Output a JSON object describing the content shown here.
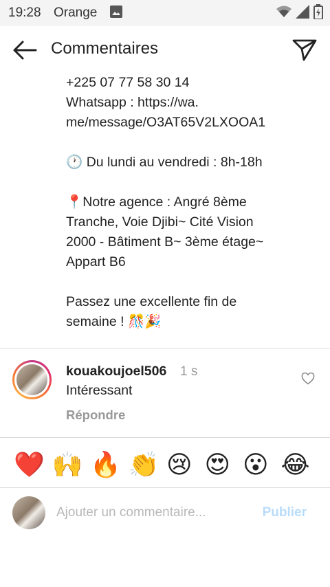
{
  "status_bar": {
    "time": "19:28",
    "carrier": "Orange"
  },
  "header": {
    "title": "Commentaires",
    "icons": {
      "back": "arrow-left-icon",
      "send": "paper-plane-icon"
    }
  },
  "caption": {
    "phone": "+225 07 77 58 30 14",
    "whatsapp_line1": "Whatsapp : https://wa.",
    "whatsapp_line2": "me/message/O3AT65V2LXOOA1",
    "hours": "🕐 Du lundi au vendredi : 8h-18h",
    "agency_line1": "📍Notre agence : Angré 8ème",
    "agency_line2": "Tranche, Voie Djibi~ Cité Vision",
    "agency_line3": "2000 - Bâtiment B~ 3ème étage~",
    "agency_line4": "Appart B6",
    "closing_line1": "Passez une excellente fin de",
    "closing_line2": "semaine ! 🎊🎉"
  },
  "comment": {
    "username": "kouakoujoel506",
    "time": "1 s",
    "text": "Intéressant",
    "reply_label": "Répondre"
  },
  "emoji_bar": {
    "emojis": [
      "❤️",
      "🙌",
      "🔥",
      "👏",
      "😢",
      "😍",
      "😮",
      "😂"
    ]
  },
  "composer": {
    "placeholder": "Ajouter un commentaire...",
    "publish_label": "Publier"
  },
  "colors": {
    "publish_disabled": "#b9dcfb",
    "muted_text": "#999999",
    "divider": "#dcdcdc",
    "status_bar_bg": "#f4f4f4"
  }
}
